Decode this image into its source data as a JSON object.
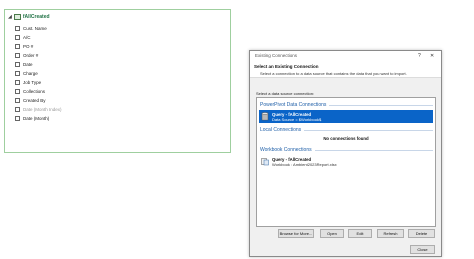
{
  "field_list": {
    "table_name": "fAllCreated",
    "fields": [
      {
        "label": "Cust. Name",
        "checked": false,
        "dim": false
      },
      {
        "label": "A/C",
        "checked": false,
        "dim": false
      },
      {
        "label": "PO #",
        "checked": false,
        "dim": false
      },
      {
        "label": "Order #",
        "checked": false,
        "dim": false
      },
      {
        "label": "Date",
        "checked": false,
        "dim": false
      },
      {
        "label": "Charge",
        "checked": false,
        "dim": false
      },
      {
        "label": "Job Type",
        "checked": false,
        "dim": false
      },
      {
        "label": "Collections",
        "checked": false,
        "dim": false
      },
      {
        "label": "Created By",
        "checked": false,
        "dim": false
      },
      {
        "label": "Date (Month Index)",
        "checked": false,
        "dim": true
      },
      {
        "label": "Date (Month)",
        "checked": false,
        "dim": false
      }
    ]
  },
  "dialog": {
    "title": "Existing Connections",
    "help_glyph": "?",
    "close_glyph": "✕",
    "header_title": "Select an Existing Connection",
    "header_subtitle": "Select a connection to a data source that contains the data that you want to import.",
    "show_label": "Select a data source connection:",
    "sections": {
      "powerpivot": {
        "label": "PowerPivot Data Connections",
        "items": [
          {
            "line1": "Query - fAllCreated",
            "line2": "Data Source = $Workbook$",
            "selected": true,
            "icon": "database-icon"
          }
        ]
      },
      "local": {
        "label": "Local Connections",
        "empty_text": "No connections found"
      },
      "workbook": {
        "label": "Workbook Connections",
        "items": [
          {
            "line1": "Query - fAllCreated",
            "line2": "Workbook : Ambient2023Report.xlsx",
            "selected": false,
            "icon": "connection-icon"
          }
        ]
      }
    },
    "buttons": {
      "browse": "Browse for More...",
      "open": "Open",
      "edit": "Edit",
      "refresh": "Refresh",
      "delete": "Delete",
      "close": "Close"
    }
  },
  "colors": {
    "selection": "#0a64c8",
    "section_text": "#1f5fa8",
    "table_name": "#217346"
  }
}
